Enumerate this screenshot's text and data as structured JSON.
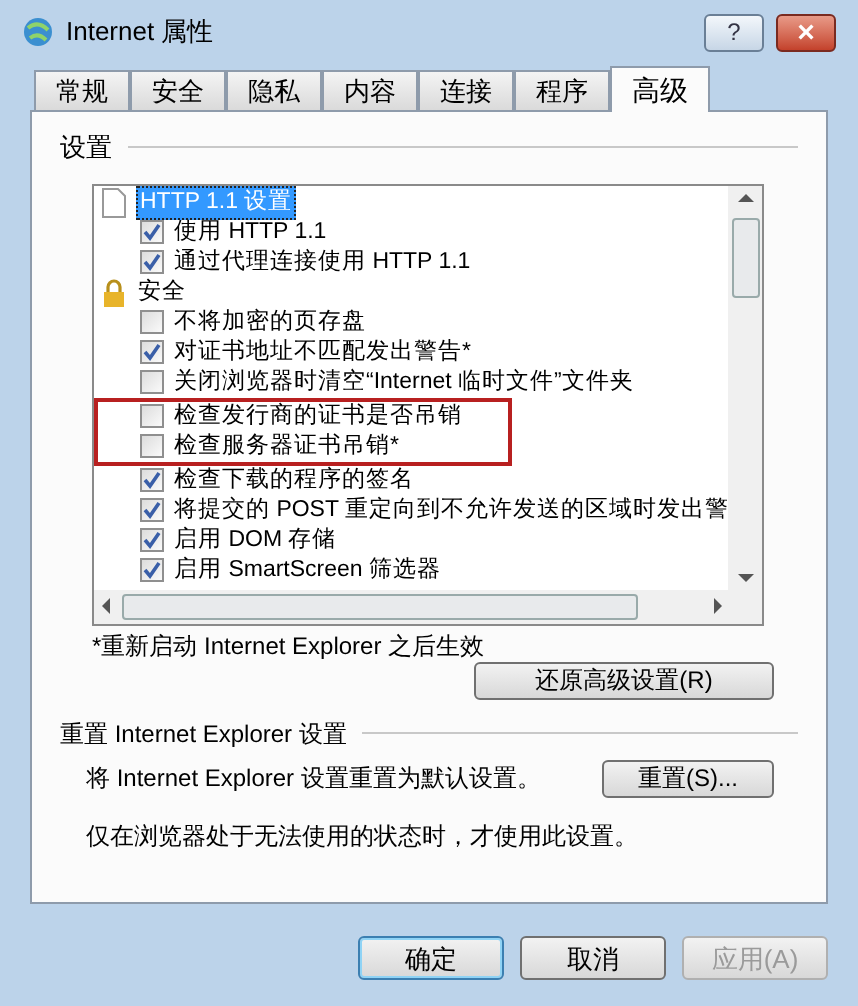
{
  "window": {
    "title": "Internet 属性",
    "help_button": "?",
    "close_button": "×"
  },
  "tabs": [
    {
      "label": "常规",
      "selected": false
    },
    {
      "label": "安全",
      "selected": false
    },
    {
      "label": "隐私",
      "selected": false
    },
    {
      "label": "内容",
      "selected": false
    },
    {
      "label": "连接",
      "selected": false
    },
    {
      "label": "程序",
      "selected": false
    },
    {
      "label": "高级",
      "selected": true
    }
  ],
  "settings": {
    "title": "设置",
    "items": [
      {
        "kind": "document",
        "label": "HTTP 1.1 设置",
        "selected": true,
        "highlighted": false
      },
      {
        "kind": "checkbox",
        "label": "使用 HTTP 1.1",
        "checked": true,
        "selected": false,
        "highlighted": false
      },
      {
        "kind": "checkbox",
        "label": "通过代理连接使用 HTTP 1.1",
        "checked": true,
        "selected": false,
        "highlighted": false
      },
      {
        "kind": "security",
        "label": "安全",
        "selected": false,
        "highlighted": false
      },
      {
        "kind": "checkbox",
        "label": "不将加密的页存盘",
        "checked": false,
        "selected": false,
        "highlighted": false
      },
      {
        "kind": "checkbox",
        "label": "对证书地址不匹配发出警告*",
        "checked": true,
        "selected": false,
        "highlighted": false
      },
      {
        "kind": "checkbox",
        "label": "关闭浏览器时清空“Internet 临时文件”文件夹",
        "checked": false,
        "selected": false,
        "highlighted": false
      },
      {
        "kind": "checkbox",
        "label": "检查发行商的证书是否吊销",
        "checked": false,
        "selected": false,
        "highlighted": true
      },
      {
        "kind": "checkbox",
        "label": "检查服务器证书吊销*",
        "checked": false,
        "selected": false,
        "highlighted": true
      },
      {
        "kind": "checkbox",
        "label": "检查下载的程序的签名",
        "checked": true,
        "selected": false,
        "highlighted": false
      },
      {
        "kind": "checkbox",
        "label": "将提交的 POST 重定向到不允许发送的区域时发出警",
        "checked": true,
        "selected": false,
        "highlighted": false
      },
      {
        "kind": "checkbox",
        "label": "启用 DOM 存储",
        "checked": true,
        "selected": false,
        "highlighted": false
      },
      {
        "kind": "checkbox",
        "label": "启用 SmartScreen 筛选器",
        "checked": true,
        "selected": false,
        "highlighted": false
      }
    ],
    "note": "*重新启动 Internet Explorer 之后生效",
    "restore_button": "还原高级设置(R)"
  },
  "reset": {
    "title": "重置 Internet Explorer 设置",
    "description": "将 Internet Explorer 设置重置为默认设置。",
    "button": "重置(S)...",
    "hint": "仅在浏览器处于无法使用的状态时，才使用此设置。"
  },
  "buttons": [
    {
      "label": "确定",
      "kind": "default",
      "disabled": false
    },
    {
      "label": "取消",
      "kind": "normal",
      "disabled": false
    },
    {
      "label": "应用(A)",
      "kind": "normal",
      "disabled": true
    }
  ]
}
